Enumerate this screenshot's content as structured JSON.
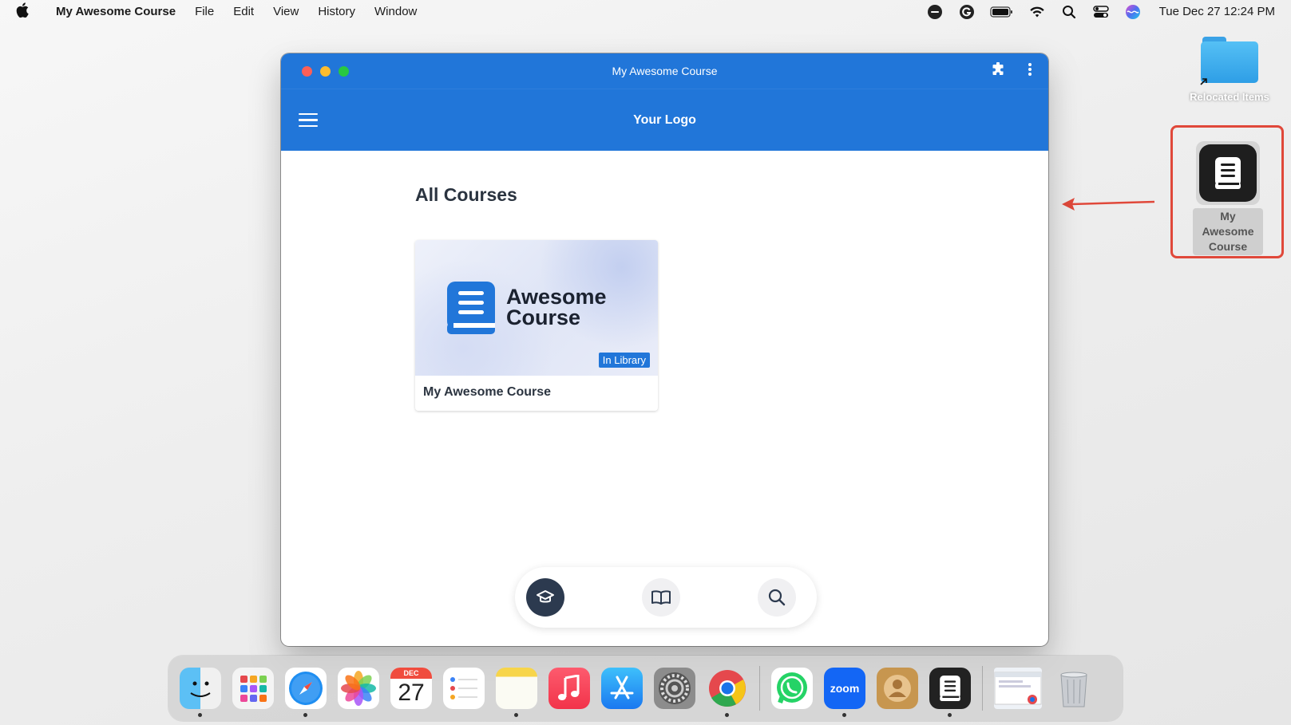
{
  "menubar": {
    "app_name": "My Awesome Course",
    "menus": [
      "File",
      "Edit",
      "View",
      "History",
      "Window"
    ],
    "clock": "Tue Dec 27  12:24 PM"
  },
  "desktop": {
    "folder_label": "Relocated Items",
    "app_label": "My Awesome Course"
  },
  "window": {
    "title": "My Awesome Course",
    "logo": "Your Logo",
    "section_title": "All Courses",
    "course": {
      "brand_line1": "Awesome",
      "brand_line2": "Course",
      "badge": "In Library",
      "title": "My Awesome Course"
    }
  },
  "dock": {
    "calendar_month": "DEC",
    "calendar_day": "27",
    "zoom_label": "zoom"
  },
  "colors": {
    "primary": "#2176d9",
    "nav_active": "#2c3a4f",
    "highlight": "#e0483a"
  }
}
